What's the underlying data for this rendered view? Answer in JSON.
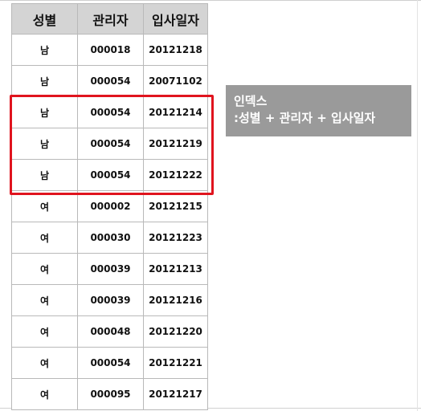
{
  "table": {
    "headers": [
      "성별",
      "관리자",
      "입사일자"
    ],
    "rows": [
      [
        "남",
        "000018",
        "20121218"
      ],
      [
        "남",
        "000054",
        "20071102"
      ],
      [
        "남",
        "000054",
        "20121214"
      ],
      [
        "남",
        "000054",
        "20121219"
      ],
      [
        "남",
        "000054",
        "20121222"
      ],
      [
        "여",
        "000002",
        "20121215"
      ],
      [
        "여",
        "000030",
        "20121223"
      ],
      [
        "여",
        "000039",
        "20121213"
      ],
      [
        "여",
        "000039",
        "20121216"
      ],
      [
        "여",
        "000048",
        "20121220"
      ],
      [
        "여",
        "000054",
        "20121221"
      ],
      [
        "여",
        "000095",
        "20121217"
      ]
    ]
  },
  "highlight": {
    "rows": [
      2,
      3,
      4
    ],
    "color": "#e0141e"
  },
  "index_note": {
    "line1": "인덱스",
    "line2": ":성별 + 관리자 + 입사일자",
    "background": "#9a9a9a"
  }
}
